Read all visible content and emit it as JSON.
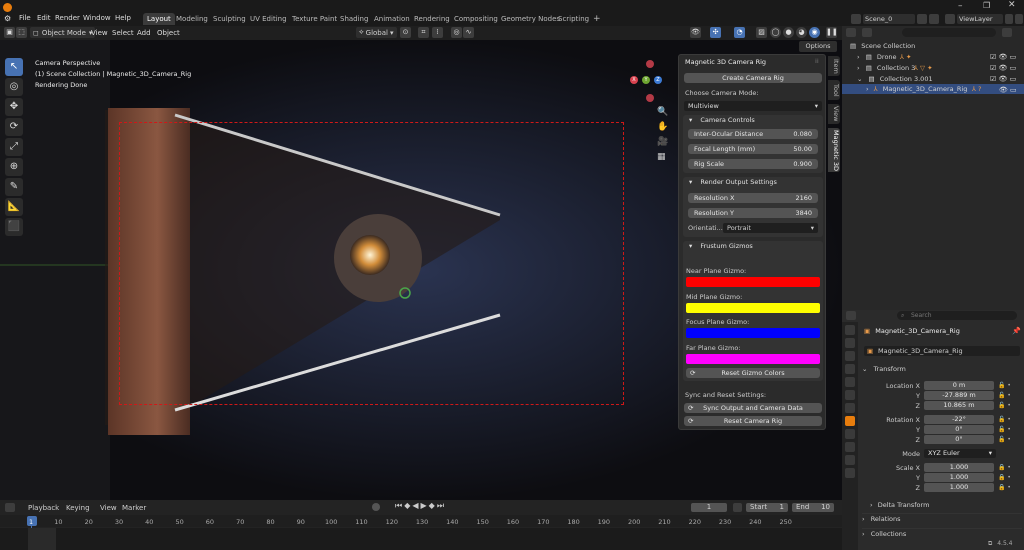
{
  "menus": [
    "File",
    "Edit",
    "Render",
    "Window",
    "Help"
  ],
  "workspaces": [
    "Layout",
    "Modeling",
    "Sculpting",
    "UV Editing",
    "Texture Paint",
    "Shading",
    "Animation",
    "Rendering",
    "Compositing",
    "Geometry Nodes",
    "Scripting"
  ],
  "add_workspace": "+",
  "scene_name": "Scene_0",
  "view_layer": "ViewLayer",
  "viewport_header": {
    "mode": "Object Mode",
    "view": "View",
    "select": "Select",
    "add": "Add",
    "object": "Object",
    "orientation": "Global",
    "options": "Options"
  },
  "overlay_text": {
    "line1": "Camera Perspective",
    "line2": "(1) Scene Collection | Magnetic_3D_Camera_Rig",
    "line3": "Rendering Done"
  },
  "gizmo": {
    "x": "X",
    "y": "Y",
    "z": "Z"
  },
  "npanel": {
    "title": "Magnetic 3D Camera Rig",
    "create_btn": "Create Camera Rig",
    "mode_label": "Choose Camera Mode:",
    "mode_value": "Multiview",
    "camera_controls": "Camera Controls",
    "iod_label": "Inter-Ocular Distance",
    "iod_value": "0.080",
    "focal_label": "Focal Length (mm)",
    "focal_value": "50.00",
    "rig_label": "Rig Scale",
    "rig_value": "0.900",
    "render_settings": "Render Output Settings",
    "resx_label": "Resolution X",
    "resx_value": "2160",
    "resy_label": "Resolution Y",
    "resy_value": "3840",
    "orient_label": "Orientati...",
    "orient_value": "Portrait",
    "frustum": "Frustum Gizmos",
    "near_label": "Near Plane Gizmo:",
    "mid_label": "Mid Plane Gizmo:",
    "focus_label": "Focus Plane Gizmo:",
    "far_label": "Far Plane Gizmo:",
    "reset_colors": "Reset Gizmo Colors",
    "sync_label": "Sync and Reset Settings:",
    "sync_btn": "Sync Output and Camera Data",
    "reset_rig": "Reset Camera Rig",
    "colors": {
      "near": "#ff0000",
      "mid": "#ffff00",
      "focus": "#0000ff",
      "far": "#ff00ff"
    }
  },
  "vtabs": [
    "Item",
    "Tool",
    "View",
    "Magnetic 3D"
  ],
  "outliner": {
    "root": "Scene Collection",
    "items": [
      "Drone",
      "Collection 3",
      "Collection 3.001",
      "Magnetic_3D_Camera_Rig"
    ]
  },
  "props": {
    "search_placeholder": "Search",
    "object_name": "Magnetic_3D_Camera_Rig",
    "object_name2": "Magnetic_3D_Camera_Rig",
    "transform": "Transform",
    "location_x_label": "Location X",
    "y_label": "Y",
    "z_label": "Z",
    "loc_x": "0 m",
    "loc_y": "-27.889 m",
    "loc_z": "10.865 m",
    "rotation_x_label": "Rotation X",
    "rot_x": "-22°",
    "rot_y": "0°",
    "rot_z": "0°",
    "mode_label": "Mode",
    "mode_value": "XYZ Euler",
    "scale_x_label": "Scale X",
    "scale_x": "1.000",
    "scale_y": "1.000",
    "scale_z": "1.000",
    "delta": "Delta Transform",
    "relations": "Relations",
    "collections": "Collections"
  },
  "timeline": {
    "playback": "Playback",
    "keying": "Keying",
    "view": "View",
    "marker": "Marker",
    "current_frame": "1",
    "start_label": "Start",
    "start": "1",
    "end_label": "End",
    "end": "10",
    "ticks": [
      "1",
      "10",
      "20",
      "30",
      "40",
      "50",
      "60",
      "70",
      "80",
      "90",
      "100",
      "110",
      "120",
      "130",
      "140",
      "150",
      "160",
      "170",
      "180",
      "190",
      "200",
      "210",
      "220",
      "230",
      "240",
      "250"
    ]
  },
  "version": "4.5.4"
}
